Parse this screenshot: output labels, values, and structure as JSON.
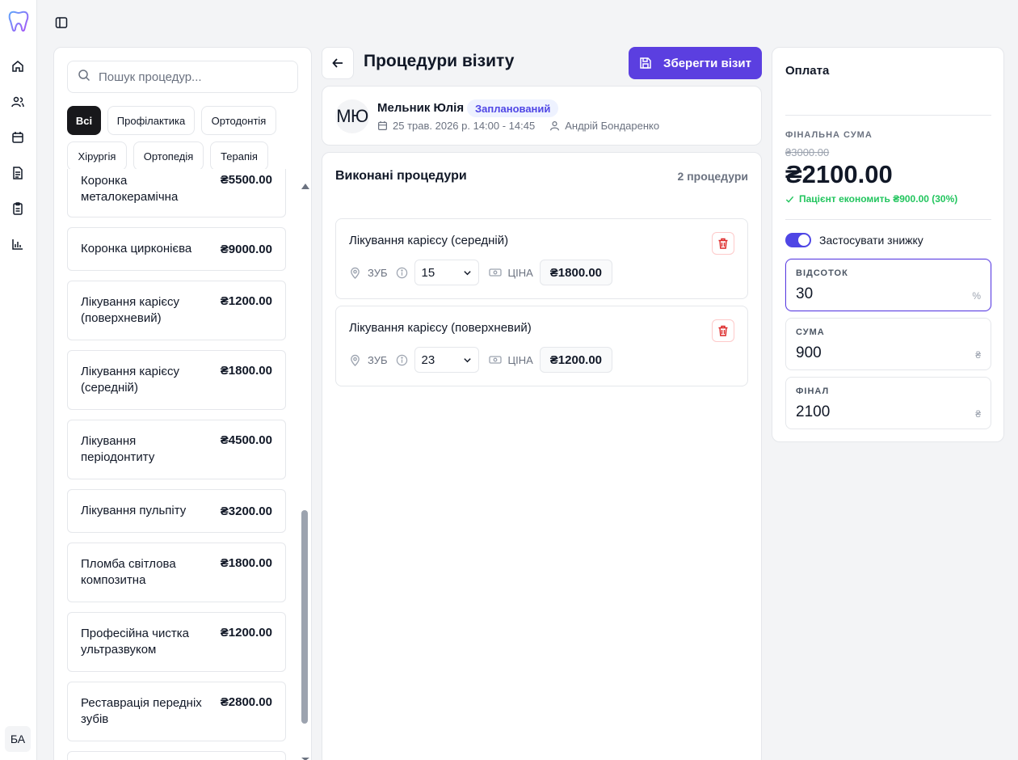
{
  "app": {
    "user_initials": "БА",
    "nav_icons": [
      "home-icon",
      "users-icon",
      "calendar-icon",
      "document-icon",
      "clipboard-icon",
      "chart-icon"
    ]
  },
  "procedures_panel": {
    "search_placeholder": "Пошук процедур...",
    "filters": [
      "Всі",
      "Профілактика",
      "Ортодонтія",
      "Хірургія",
      "Ортопедія",
      "Терапія"
    ],
    "active_filter": "Всі",
    "items": [
      {
        "name": "Коронка металокерамічна",
        "price": "₴5500.00"
      },
      {
        "name": "Коронка цирконієва",
        "price": "₴9000.00"
      },
      {
        "name": "Лікування карієсу (поверхневий)",
        "price": "₴1200.00"
      },
      {
        "name": "Лікування карієсу (середній)",
        "price": "₴1800.00"
      },
      {
        "name": "Лікування періодонтиту",
        "price": "₴4500.00"
      },
      {
        "name": "Лікування пульпіту",
        "price": "₴3200.00"
      },
      {
        "name": "Пломба світлова композитна",
        "price": "₴1800.00"
      },
      {
        "name": "Професійна чистка ультразвуком",
        "price": "₴1200.00"
      },
      {
        "name": "Реставрація передніх зубів",
        "price": "₴2800.00"
      }
    ]
  },
  "header": {
    "title": "Процедури візиту",
    "save_label": "Зберегти візит"
  },
  "visit": {
    "avatar": "МЮ",
    "patient": "Мельник Юлія",
    "status": "Запланований",
    "datetime": "25 трав. 2026 р. 14:00 - 14:45",
    "doctor": "Андрій Бондаренко"
  },
  "performed": {
    "title": "Виконані процедури",
    "count": "2 процедури",
    "tooth_label": "ЗУБ",
    "price_label": "ЦІНА",
    "items": [
      {
        "name": "Лікування карієсу (середній)",
        "tooth": "15",
        "price": "₴1800.00"
      },
      {
        "name": "Лікування карієсу (поверхневий)",
        "tooth": "23",
        "price": "₴1200.00"
      }
    ]
  },
  "payment": {
    "title": "Оплата",
    "final_label": "ФІНАЛЬНА СУМА",
    "original": "₴3000.00",
    "final": "₴2100.00",
    "saving": "Пацієнт економить ₴900.00 (30%)",
    "discount_label": "Застосувати знижку",
    "discount_enabled": true,
    "fields": {
      "percent": {
        "label": "ВІДСОТОК",
        "value": "30",
        "unit": "%"
      },
      "amount": {
        "label": "СУМА",
        "value": "900",
        "unit": "₴"
      },
      "final": {
        "label": "ФІНАЛ",
        "value": "2100",
        "unit": "₴"
      }
    }
  },
  "colors": {
    "accent": "#5b3fe0",
    "success": "#22c55e",
    "danger": "#dc2626"
  }
}
